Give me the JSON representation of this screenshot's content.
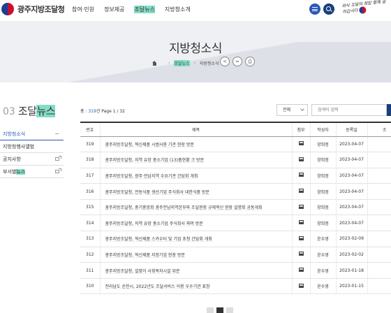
{
  "header": {
    "logo_text": "광주지방조달청",
    "nav": [
      "참여·민원",
      "정보제공",
      "조달뉴스",
      "지방청소개"
    ],
    "nav_highlight_index": 2,
    "slogan": "와식 조달의 희망 함께 걸어갑시다"
  },
  "banner": {
    "title": "지방청소식",
    "breadcrumb": [
      "조달뉴스",
      "지방청소식"
    ]
  },
  "sidebar": {
    "number": "03",
    "title": "조달뉴스",
    "items": [
      {
        "label": "지방청소식",
        "marker": "−",
        "active": true
      },
      {
        "label": "지방청행사앨범",
        "marker": "",
        "active": false
      },
      {
        "label": "공지사항",
        "marker": "ext",
        "active": false
      },
      {
        "label": "부서별뉴스",
        "marker": "ext",
        "active": false
      }
    ]
  },
  "board": {
    "total_prefix": "총 : ",
    "total_count": "319",
    "total_suffix": "건 Page ",
    "page_current": "1",
    "page_total": " / 32",
    "select_value": "전체",
    "search_placeholder": "검색어 입력",
    "columns": [
      "번호",
      "제목",
      "첨부",
      "작성자",
      "등록일",
      "조"
    ],
    "rows": [
      {
        "no": "319",
        "title": "광주지방조달청, 혁신제품 시범사용 기관 현장 방문",
        "writer": "양희정",
        "date": "2023-04-07"
      },
      {
        "no": "318",
        "title": "광주지방조달청, 지역 유망 중소기업 (13)품현황 크 방문",
        "writer": "양희정",
        "date": "2023-04-07"
      },
      {
        "no": "317",
        "title": "광주지방조달청, 광주·전남지역 수요기관 간담회 개최",
        "writer": "양희정",
        "date": "2023-04-07"
      },
      {
        "no": "316",
        "title": "광주지방조달청, 전동식품 생산기업 주식회사 대한식품 방문",
        "writer": "양희정",
        "date": "2023-04-07"
      },
      {
        "no": "315",
        "title": "광주지방조달청, 중기중앙회 광주전남지역본부와 조달현장 규제혁신 현장 설명회 공동개최",
        "writer": "양희정",
        "date": "2023-04-07"
      },
      {
        "no": "314",
        "title": "광주지방조달청, 지역 유망 중소기업 주식회사 파머 방문",
        "writer": "양희정",
        "date": "2023-04-07"
      },
      {
        "no": "313",
        "title": "광주지방조달청, 혁신제품 스카우터 및 기업 초청 간담회 개최",
        "writer": "윤수영",
        "date": "2023-02-09"
      },
      {
        "no": "312",
        "title": "광주지방조달청, 혁신제품 지정기업 현장 방문",
        "writer": "윤수영",
        "date": "2023-02-02"
      },
      {
        "no": "311",
        "title": "광주지방조달청, 설맞이 사회복지시설 위문",
        "writer": "윤수영",
        "date": "2023-01-18"
      },
      {
        "no": "310",
        "title": "전라남도 순천시, 2022년도 조달서비스 이용 우수기관 표창",
        "writer": "윤수영",
        "date": "2023-01-15"
      }
    ]
  }
}
